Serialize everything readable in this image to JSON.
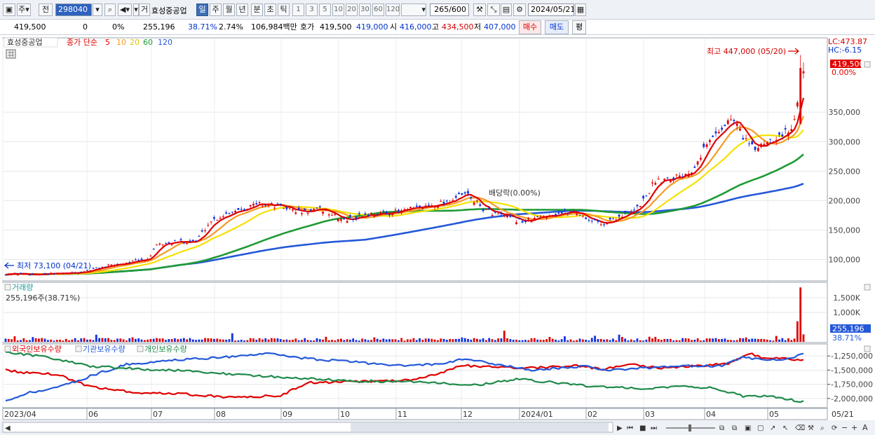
{
  "toolbar": {
    "market": "주",
    "prev": "전",
    "code": "298040",
    "ge": "거",
    "stock_name": "효성중공업",
    "periods": [
      "일",
      "주",
      "월",
      "년",
      "분",
      "초",
      "틱"
    ],
    "active_period": "일",
    "multipliers": [
      "1",
      "3",
      "5",
      "10",
      "20",
      "30",
      "60",
      "120"
    ],
    "count": "265",
    "count_max": "/600",
    "date": "2024/05/21"
  },
  "quote": {
    "price": "419,500",
    "change": "0",
    "change_pct": "0%",
    "volume": "255,196",
    "volume_ratio": "38.71%",
    "turnover": "2.74%",
    "amount": "106,984백만",
    "hoga_label": "호가",
    "hoga": "419,500",
    "ask": "419,000",
    "open_label": "시",
    "open": "416,000",
    "high_label": "고",
    "high": "434,500",
    "low_label": "저",
    "low": "407,000",
    "buy_btn": "매수",
    "sell_btn": "매도",
    "eval_btn": "평"
  },
  "legend": {
    "stock": "효성중공업",
    "ma_label": "종가 단순",
    "ma_periods": [
      "5",
      "10",
      "20",
      "60",
      "120"
    ],
    "ma_colors": [
      "#e00000",
      "#f59a23",
      "#f5e100",
      "#1f9a36",
      "#2458d8"
    ]
  },
  "annotations": {
    "high_marker": "최고 447,000 (05/20)",
    "low_marker": "최저 73,100 (04/21)",
    "dividend": "배당락(0.00%)",
    "lc": "LC:473.87",
    "hc": "HC:-6.15",
    "price_tag": "419,500",
    "pct_tag": "0.00%"
  },
  "volume_panel": {
    "title": "거래량",
    "value": "255,196주(38.71%)",
    "tag_value": "255,196",
    "tag_pct": "38.71%"
  },
  "holding_panel": {
    "series": [
      "외국인보유수량",
      "기관보유수량",
      "개인보유수량"
    ],
    "colors": [
      "#e00000",
      "#2458d8",
      "#1f8a4a"
    ]
  },
  "axis": {
    "x_labels": [
      "2023/04",
      "06",
      "07",
      "08",
      "09",
      "10",
      "11",
      "12",
      "2024/01",
      "02",
      "03",
      "04",
      "05"
    ],
    "x_right": "05/21"
  },
  "chart_data": [
    {
      "type": "line",
      "title": "",
      "series_note": "candlestick daily prices with moving averages",
      "x": [
        "2023/04",
        "06",
        "07",
        "08",
        "09",
        "10",
        "11",
        "12",
        "2024/01",
        "02",
        "03",
        "04",
        "05"
      ],
      "ylim": [
        65000,
        475000
      ],
      "y_ticks": [
        100000,
        150000,
        200000,
        250000,
        300000,
        350000
      ],
      "y_tick_labels": [
        "100,000",
        "150,000",
        "200,000",
        "250,000",
        "300,000",
        "350,000"
      ],
      "series": [
        {
          "name": "종가",
          "values": [
            76000,
            90000,
            125000,
            185000,
            188000,
            175000,
            180000,
            210000,
            168000,
            162000,
            240000,
            315000,
            300000,
            419500
          ]
        },
        {
          "name": "120",
          "values": [
            75000,
            80000,
            90000,
            110000,
            128000,
            140000,
            152000,
            165000,
            172000,
            175000,
            178000,
            192000,
            210000,
            225000
          ]
        }
      ]
    },
    {
      "type": "bar",
      "title": "",
      "ylim": [
        0,
        2000000
      ],
      "y_ticks": [
        1000000,
        1500000
      ],
      "y_tick_labels": [
        "1,000K",
        "1,500K"
      ],
      "values": [
        255196
      ]
    },
    {
      "type": "line",
      "title": "",
      "ylim": [
        -2150000,
        -1050000
      ],
      "y_ticks": [
        -1250000,
        -1500000,
        -1750000,
        -2000000
      ],
      "y_tick_labels": [
        "-1,250,000",
        "-1,500,000",
        "-1,750,000",
        "-2,000,000"
      ]
    }
  ]
}
